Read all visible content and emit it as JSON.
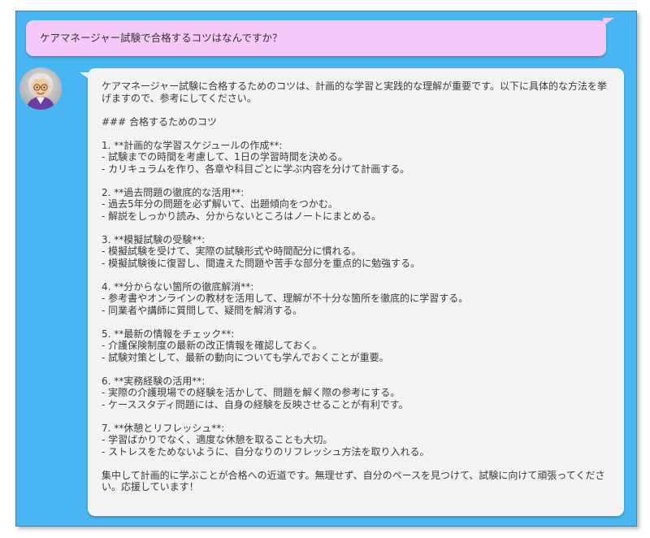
{
  "conversation": {
    "user_message": "ケアマネージャー試験で合格するコツはなんですか？",
    "assistant_message": "ケアマネージャー試験に合格するためのコツは、計画的な学習と実践的な理解が重要です。以下に具体的な方法を挙げますので、参考にしてください。\n\n### 合格するためのコツ\n\n1. **計画的な学習スケジュールの作成**:\n- 試験までの時間を考慮して、1日の学習時間を決める。\n- カリキュラムを作り、各章や科目ごとに学ぶ内容を分けて計画する。\n\n2. **過去問題の徹底的な活用**:\n- 過去5年分の問題を必ず解いて、出題傾向をつかむ。\n- 解説をしっかり読み、分からないところはノートにまとめる。\n\n3. **模擬試験の受験**:\n- 模擬試験を受けて、実際の試験形式や時間配分に慣れる。\n- 模擬試験後に復習し、間違えた問題や苦手な部分を重点的に勉強する。\n\n4. **分からない箇所の徹底解消**:\n- 参考書やオンラインの教材を活用して、理解が不十分な箇所を徹底的に学習する。\n- 同業者や講師に質問して、疑問を解消する。\n\n5. **最新の情報をチェック**:\n- 介護保険制度の最新の改正情報を確認しておく。\n- 試験対策として、最新の動向についても学んでおくことが重要。\n\n6. **実務経験の活用**:\n- 実際の介護現場での経験を活かして、問題を解く際の参考にする。\n- ケーススタディ問題には、自身の経験を反映させることが有利です。\n\n7. **休憩とリフレッシュ**:\n- 学習ばかりでなく、適度な休憩を取ることも大切。\n- ストレスをためないように、自分なりのリフレッシュ方法を取り入れる。\n\n集中して計画的に学ぶことが合格への近道です。無理せず、自分のペースを見つけて、試験に向けて頑張ってください。応援しています！"
  },
  "avatar": {
    "icon": "elderly-woman-with-glasses-avatar-icon"
  },
  "colors": {
    "background": "#48b6f2",
    "user_bubble": "#f4c8f8",
    "assistant_bubble": "#f3f3f3",
    "text": "#3a3a3a"
  }
}
